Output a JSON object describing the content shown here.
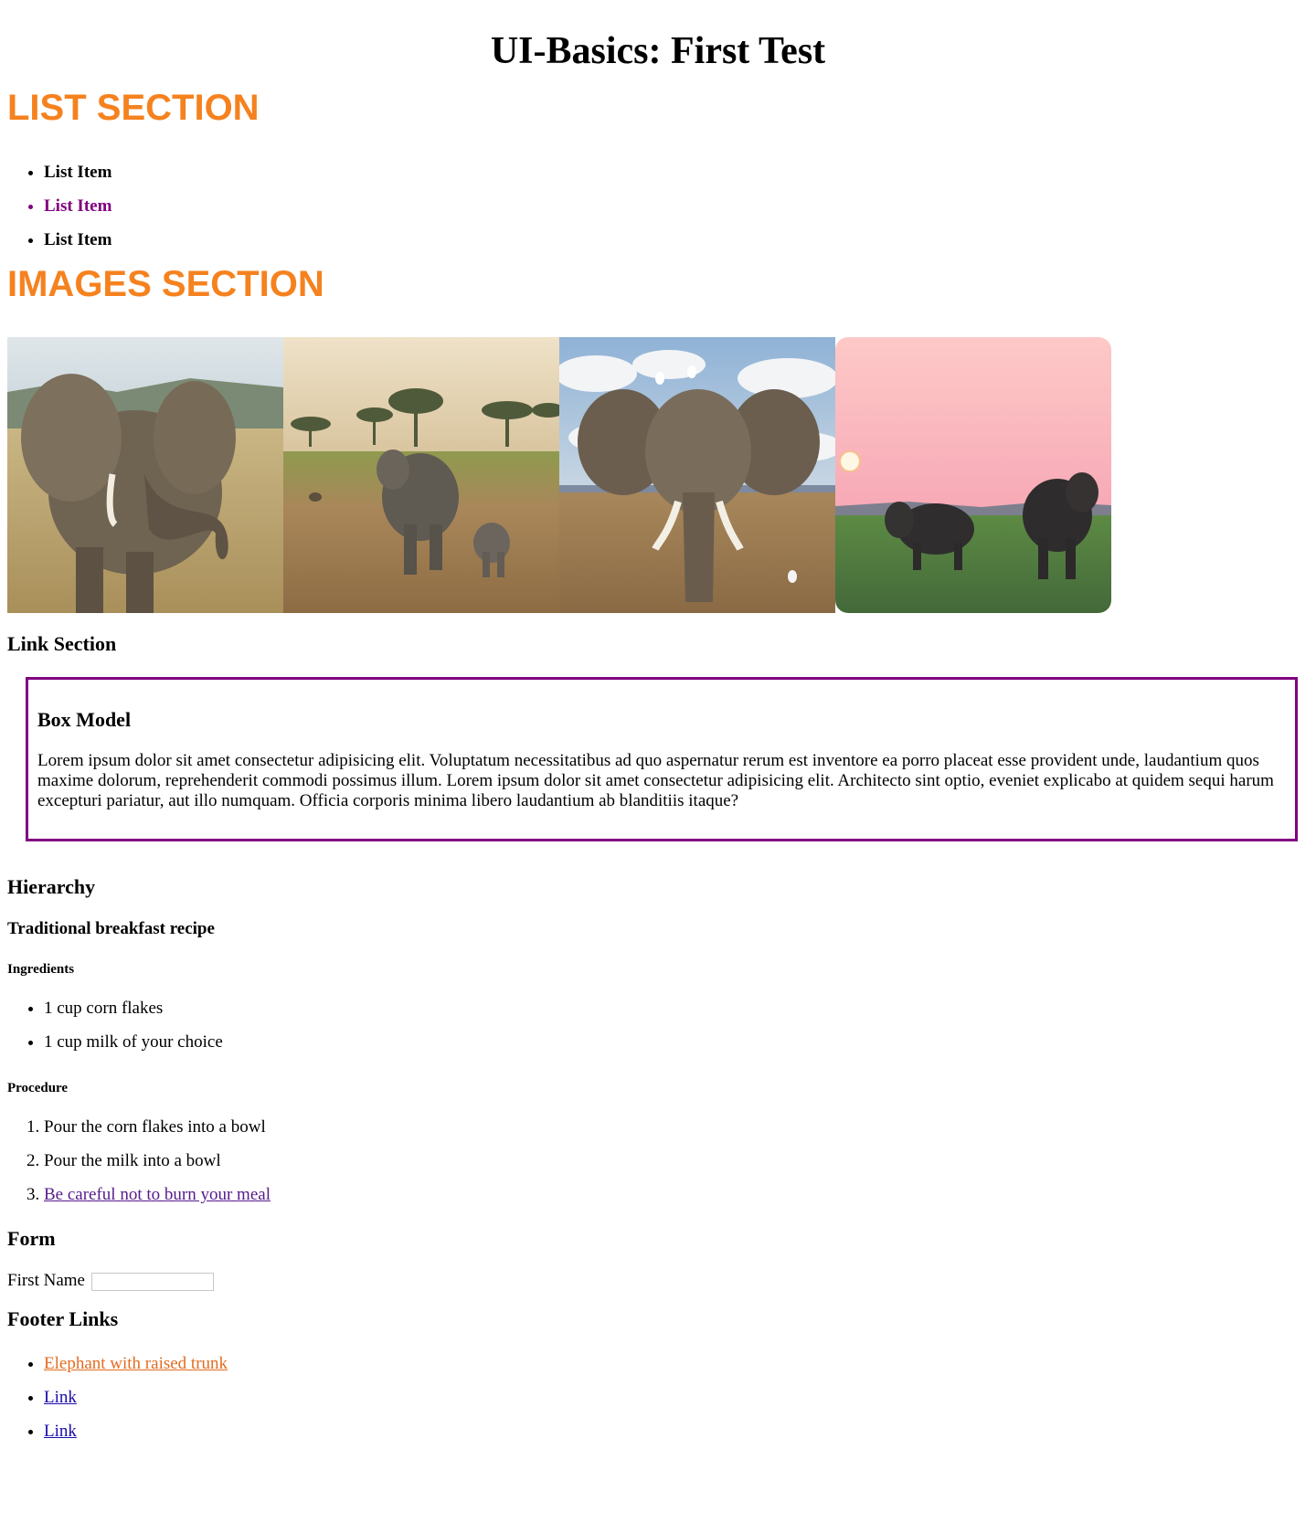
{
  "page_title": "UI-Basics: First Test",
  "list_section": {
    "heading": "LIST SECTION",
    "items": [
      "List Item",
      "List Item",
      "List Item"
    ],
    "highlight_color": "#800080"
  },
  "images_section": {
    "heading": "IMAGES SECTION",
    "accent_color": "#f5821f"
  },
  "link_section": {
    "heading": "Link Section"
  },
  "box_model": {
    "heading": "Box Model",
    "text": "Lorem ipsum dolor sit amet consectetur adipisicing elit. Voluptatum necessitatibus ad quo aspernatur rerum est inventore ea porro placeat esse provident unde, laudantium quos maxime dolorum, reprehenderit commodi possimus illum. Lorem ipsum dolor sit amet consectetur adipisicing elit. Architecto sint optio, eveniet explicabo at quidem sequi harum excepturi pariatur, aut illo numquam. Officia corporis minima libero laudantium ab blanditiis itaque?",
    "border_color": "#800080"
  },
  "hierarchy": {
    "heading": "Hierarchy",
    "recipe_title": "Traditional breakfast recipe",
    "ingredients_heading": "Ingredients",
    "ingredients": [
      "1 cup corn flakes",
      "1 cup milk of your choice"
    ],
    "procedure_heading": "Procedure",
    "steps": [
      "Pour the corn flakes into a bowl",
      "Pour the milk into a bowl"
    ],
    "step_link": "Be careful not to burn your meal"
  },
  "form": {
    "heading": "Form",
    "first_name_label": "First Name",
    "first_name_value": ""
  },
  "footer": {
    "heading": "Footer Links",
    "links": [
      "Elephant with raised trunk",
      "Link",
      "Link"
    ]
  }
}
